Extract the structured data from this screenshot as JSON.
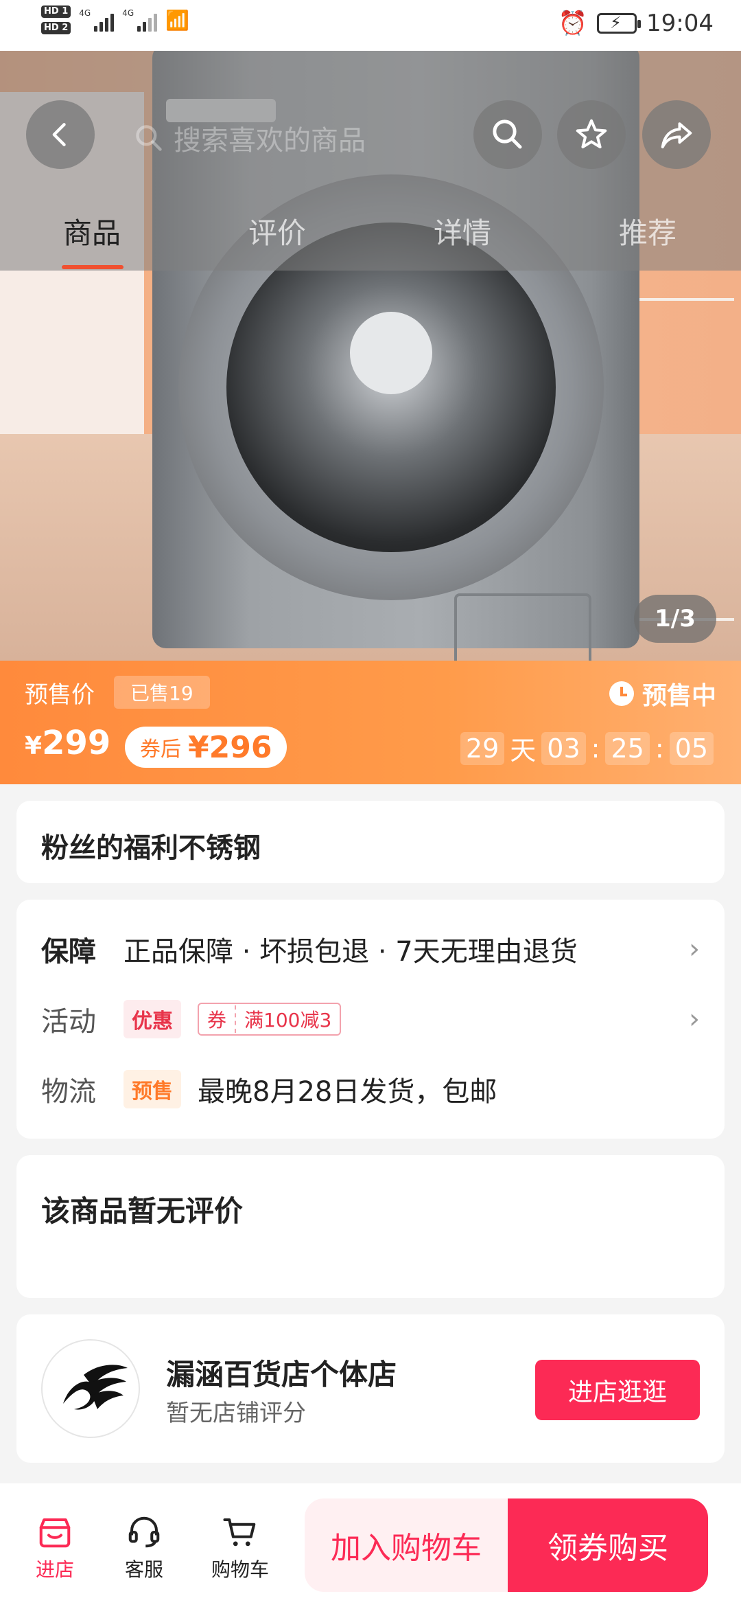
{
  "status_bar": {
    "sim1": "HD 1",
    "sim2": "HD 2",
    "net1": "4G",
    "net2": "4G",
    "time": "19:04"
  },
  "search": {
    "placeholder": "搜索喜欢的商品"
  },
  "tabs": [
    {
      "label": "商品",
      "active": true
    },
    {
      "label": "评价",
      "active": false
    },
    {
      "label": "详情",
      "active": false
    },
    {
      "label": "推荐",
      "active": false
    }
  ],
  "gallery": {
    "pager": "1/3"
  },
  "price_bar": {
    "presale_label": "预售价",
    "sold": "已售19",
    "status": "预售中",
    "currency": "¥",
    "price": "299",
    "coupon_label": "券后",
    "coupon_price": "296",
    "countdown": {
      "days": "29",
      "days_unit": "天",
      "hours": "03",
      "minutes": "25",
      "seconds": "05",
      "separator": ":"
    }
  },
  "product": {
    "title": "粉丝的福利不锈钢"
  },
  "info": {
    "guarantee_label": "保障",
    "guarantee_text": "正品保障 · 坏损包退 · 7天无理由退货",
    "activity_label": "活动",
    "activity_tag": "优惠",
    "coupon_tag_a": "券",
    "coupon_tag_b": "满100减3",
    "logistics_label": "物流",
    "logistics_tag": "预售",
    "logistics_text": "最晚8月28日发货，包邮"
  },
  "reviews": {
    "empty_text": "该商品暂无评价"
  },
  "shop": {
    "name": "漏涵百货店个体店",
    "rating": "暂无店铺评分",
    "enter_button": "进店逛逛"
  },
  "bottom_bar": {
    "store_label": "进店",
    "service_label": "客服",
    "cart_label": "购物车",
    "add_to_cart": "加入购物车",
    "buy_with_coupon": "领券购买"
  },
  "colors": {
    "accent": "#fc2a55",
    "price_bar": "#ff8a3c"
  }
}
